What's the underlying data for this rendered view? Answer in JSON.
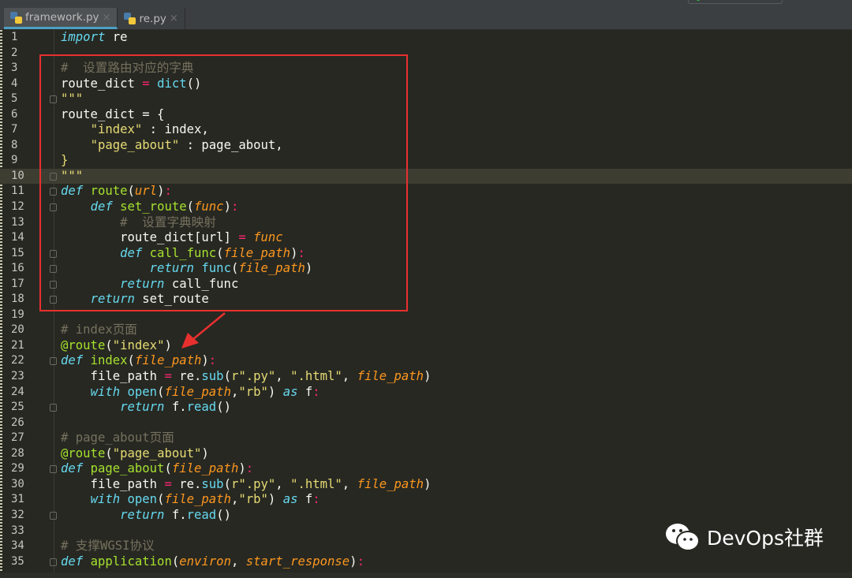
{
  "tabs": [
    {
      "label": "framework.py",
      "active": true,
      "close": "×"
    },
    {
      "label": "re.py",
      "active": false,
      "close": "×"
    }
  ],
  "colors": {
    "background": "#272822",
    "keyword": "#66d9ef",
    "function": "#a6e22e",
    "param": "#fd971f",
    "string": "#e6db74",
    "operator": "#f92672",
    "comment": "#75715e",
    "annotation": "#e8302f"
  },
  "current_line": 10,
  "watermark": "DevOps社群",
  "code": {
    "lines": [
      {
        "n": "1",
        "tokens": [
          [
            "k",
            "import"
          ],
          [
            "t",
            " re"
          ]
        ]
      },
      {
        "n": "2",
        "tokens": []
      },
      {
        "n": "3",
        "tokens": [
          [
            "c",
            "#  设置路由对应的字典"
          ]
        ]
      },
      {
        "n": "4",
        "tokens": [
          [
            "t",
            "route_dict "
          ],
          [
            "o",
            "="
          ],
          [
            "t",
            " "
          ],
          [
            "b",
            "dict"
          ],
          [
            "t",
            "()"
          ]
        ]
      },
      {
        "n": "5",
        "fold": true,
        "tokens": [
          [
            "s",
            "\"\"\""
          ]
        ]
      },
      {
        "n": "6",
        "tokens": [
          [
            "t",
            "route_dict = {"
          ]
        ]
      },
      {
        "n": "7",
        "tokens": [
          [
            "t",
            "    "
          ],
          [
            "s",
            "\"index\""
          ],
          [
            "t",
            " : index,"
          ]
        ]
      },
      {
        "n": "8",
        "tokens": [
          [
            "t",
            "    "
          ],
          [
            "s",
            "\"page_about\""
          ],
          [
            "t",
            " : page_about,"
          ]
        ]
      },
      {
        "n": "9",
        "tokens": [
          [
            "s",
            "}"
          ]
        ]
      },
      {
        "n": "10",
        "fold": true,
        "tokens": [
          [
            "s",
            "\"\"\""
          ]
        ]
      },
      {
        "n": "11",
        "fold": true,
        "tokens": [
          [
            "k",
            "def"
          ],
          [
            "t",
            " "
          ],
          [
            "f",
            "route"
          ],
          [
            "t",
            "("
          ],
          [
            "p",
            "url"
          ],
          [
            "t",
            ")"
          ],
          [
            "o",
            ":"
          ]
        ]
      },
      {
        "n": "12",
        "fold": true,
        "tokens": [
          [
            "t",
            "    "
          ],
          [
            "k",
            "def"
          ],
          [
            "t",
            " "
          ],
          [
            "f",
            "set_route"
          ],
          [
            "t",
            "("
          ],
          [
            "p",
            "func"
          ],
          [
            "t",
            ")"
          ],
          [
            "o",
            ":"
          ]
        ]
      },
      {
        "n": "13",
        "tokens": [
          [
            "t",
            "        "
          ],
          [
            "c",
            "#  设置字典映射"
          ]
        ]
      },
      {
        "n": "14",
        "tokens": [
          [
            "t",
            "        route_dict[url] "
          ],
          [
            "o",
            "="
          ],
          [
            "t",
            " "
          ],
          [
            "p",
            "func"
          ]
        ]
      },
      {
        "n": "15",
        "fold": true,
        "tokens": [
          [
            "t",
            "        "
          ],
          [
            "k",
            "def"
          ],
          [
            "t",
            " "
          ],
          [
            "f",
            "call_func"
          ],
          [
            "t",
            "("
          ],
          [
            "p",
            "file_path"
          ],
          [
            "t",
            ")"
          ],
          [
            "o",
            ":"
          ]
        ]
      },
      {
        "n": "16",
        "fold": true,
        "tokens": [
          [
            "t",
            "            "
          ],
          [
            "k",
            "return"
          ],
          [
            "t",
            " "
          ],
          [
            "b",
            "func"
          ],
          [
            "t",
            "("
          ],
          [
            "p",
            "file_path"
          ],
          [
            "t",
            ")"
          ]
        ]
      },
      {
        "n": "17",
        "fold": true,
        "tokens": [
          [
            "t",
            "        "
          ],
          [
            "k",
            "return"
          ],
          [
            "t",
            " call_func"
          ]
        ]
      },
      {
        "n": "18",
        "fold": true,
        "tokens": [
          [
            "t",
            "    "
          ],
          [
            "k",
            "return"
          ],
          [
            "t",
            " set_route"
          ]
        ]
      },
      {
        "n": "19",
        "tokens": []
      },
      {
        "n": "20",
        "tokens": [
          [
            "c",
            "# index页面"
          ]
        ]
      },
      {
        "n": "21",
        "tokens": [
          [
            "d",
            "@route"
          ],
          [
            "t",
            "("
          ],
          [
            "s",
            "\"index\""
          ],
          [
            "t",
            ")"
          ]
        ]
      },
      {
        "n": "22",
        "fold": true,
        "tokens": [
          [
            "k",
            "def"
          ],
          [
            "t",
            " "
          ],
          [
            "f",
            "index"
          ],
          [
            "t",
            "("
          ],
          [
            "p",
            "file_path"
          ],
          [
            "t",
            ")"
          ],
          [
            "o",
            ":"
          ]
        ]
      },
      {
        "n": "23",
        "tokens": [
          [
            "t",
            "    file_path "
          ],
          [
            "o",
            "="
          ],
          [
            "t",
            " re."
          ],
          [
            "b",
            "sub"
          ],
          [
            "t",
            "("
          ],
          [
            "s",
            "r\".py\""
          ],
          [
            "t",
            ", "
          ],
          [
            "s",
            "\".html\""
          ],
          [
            "t",
            ", "
          ],
          [
            "p",
            "file_path"
          ],
          [
            "t",
            ")"
          ]
        ]
      },
      {
        "n": "24",
        "tokens": [
          [
            "t",
            "    "
          ],
          [
            "k",
            "with"
          ],
          [
            "t",
            " "
          ],
          [
            "b",
            "open"
          ],
          [
            "t",
            "("
          ],
          [
            "p",
            "file_path"
          ],
          [
            "t",
            ","
          ],
          [
            "s",
            "\"rb\""
          ],
          [
            "t",
            ") "
          ],
          [
            "k",
            "as"
          ],
          [
            "t",
            " f"
          ],
          [
            "o",
            ":"
          ]
        ]
      },
      {
        "n": "25",
        "fold": true,
        "tokens": [
          [
            "t",
            "        "
          ],
          [
            "k",
            "return"
          ],
          [
            "t",
            " f."
          ],
          [
            "b",
            "read"
          ],
          [
            "t",
            "()"
          ]
        ]
      },
      {
        "n": "26",
        "tokens": []
      },
      {
        "n": "27",
        "tokens": [
          [
            "c",
            "# page_about页面"
          ]
        ]
      },
      {
        "n": "28",
        "tokens": [
          [
            "d",
            "@route"
          ],
          [
            "t",
            "("
          ],
          [
            "s",
            "\"page_about\""
          ],
          [
            "t",
            ")"
          ]
        ]
      },
      {
        "n": "29",
        "fold": true,
        "tokens": [
          [
            "k",
            "def"
          ],
          [
            "t",
            " "
          ],
          [
            "f",
            "page_about"
          ],
          [
            "t",
            "("
          ],
          [
            "p",
            "file_path"
          ],
          [
            "t",
            ")"
          ],
          [
            "o",
            ":"
          ]
        ]
      },
      {
        "n": "30",
        "tokens": [
          [
            "t",
            "    file_path "
          ],
          [
            "o",
            "="
          ],
          [
            "t",
            " re."
          ],
          [
            "b",
            "sub"
          ],
          [
            "t",
            "("
          ],
          [
            "s",
            "r\".py\""
          ],
          [
            "t",
            ", "
          ],
          [
            "s",
            "\".html\""
          ],
          [
            "t",
            ", "
          ],
          [
            "p",
            "file_path"
          ],
          [
            "t",
            ")"
          ]
        ]
      },
      {
        "n": "31",
        "tokens": [
          [
            "t",
            "    "
          ],
          [
            "k",
            "with"
          ],
          [
            "t",
            " "
          ],
          [
            "b",
            "open"
          ],
          [
            "t",
            "("
          ],
          [
            "p",
            "file_path"
          ],
          [
            "t",
            ","
          ],
          [
            "s",
            "\"rb\""
          ],
          [
            "t",
            ") "
          ],
          [
            "k",
            "as"
          ],
          [
            "t",
            " f"
          ],
          [
            "o",
            ":"
          ]
        ]
      },
      {
        "n": "32",
        "fold": true,
        "tokens": [
          [
            "t",
            "        "
          ],
          [
            "k",
            "return"
          ],
          [
            "t",
            " f."
          ],
          [
            "b",
            "read"
          ],
          [
            "t",
            "()"
          ]
        ]
      },
      {
        "n": "33",
        "tokens": []
      },
      {
        "n": "34",
        "tokens": [
          [
            "c",
            "# 支撑WGSI协议"
          ]
        ]
      },
      {
        "n": "35",
        "fold": true,
        "tokens": [
          [
            "k",
            "def"
          ],
          [
            "t",
            " "
          ],
          [
            "f",
            "application"
          ],
          [
            "t",
            "("
          ],
          [
            "p",
            "environ"
          ],
          [
            "t",
            ", "
          ],
          [
            "p",
            "start_response"
          ],
          [
            "t",
            ")"
          ],
          [
            "o",
            ":"
          ]
        ]
      }
    ]
  }
}
